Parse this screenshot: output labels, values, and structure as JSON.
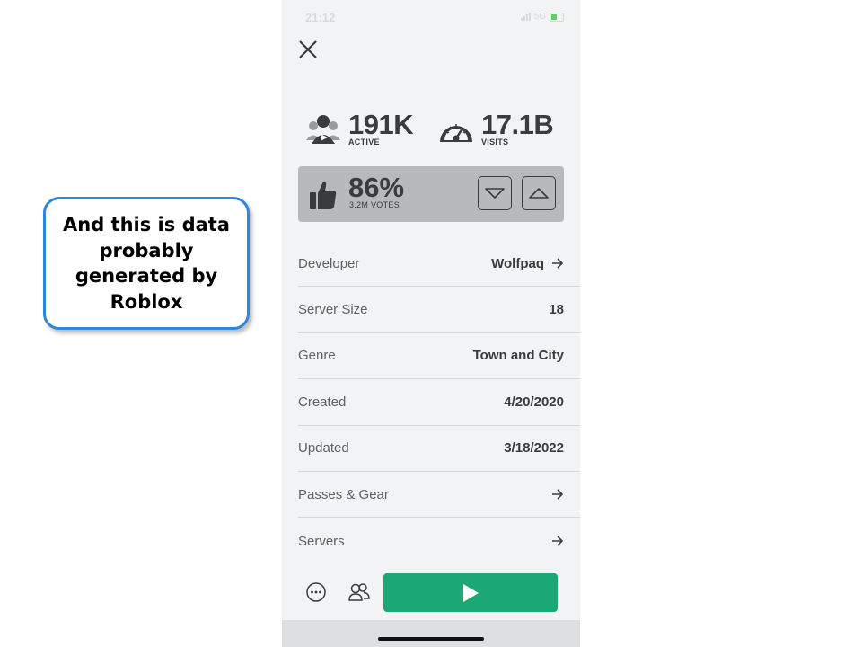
{
  "callout": {
    "text": "And this is data probably generated by Roblox"
  },
  "status_bar": {
    "time": "21:12",
    "network": "5G"
  },
  "stats": {
    "active": {
      "value": "191K",
      "label": "ACTIVE"
    },
    "visits": {
      "value": "17.1B",
      "label": "VISITS"
    }
  },
  "rating": {
    "percent": "86%",
    "votes": "3.2M VOTES"
  },
  "info": [
    {
      "label": "Developer",
      "value": "Wolfpaq",
      "arrow": true
    },
    {
      "label": "Server Size",
      "value": "18",
      "arrow": false
    },
    {
      "label": "Genre",
      "value": "Town and City",
      "arrow": false
    },
    {
      "label": "Created",
      "value": "4/20/2020",
      "arrow": false
    },
    {
      "label": "Updated",
      "value": "3/18/2022",
      "arrow": false
    },
    {
      "label": "Passes & Gear",
      "value": "",
      "arrow": true
    },
    {
      "label": "Servers",
      "value": "",
      "arrow": true
    }
  ],
  "icons": {
    "close": "close-icon",
    "active": "users-play-icon",
    "visits": "speedometer-icon",
    "thumb": "thumbs-up-icon",
    "vote_down": "chevron-down-icon",
    "vote_up": "chevron-up-icon",
    "arrow": "arrow-right-icon",
    "more": "more-icon",
    "friends": "friends-icon",
    "play": "play-icon"
  },
  "colors": {
    "play_button": "#00b06f",
    "callout_border": "#2e86de",
    "background": "#f2f3f5"
  }
}
